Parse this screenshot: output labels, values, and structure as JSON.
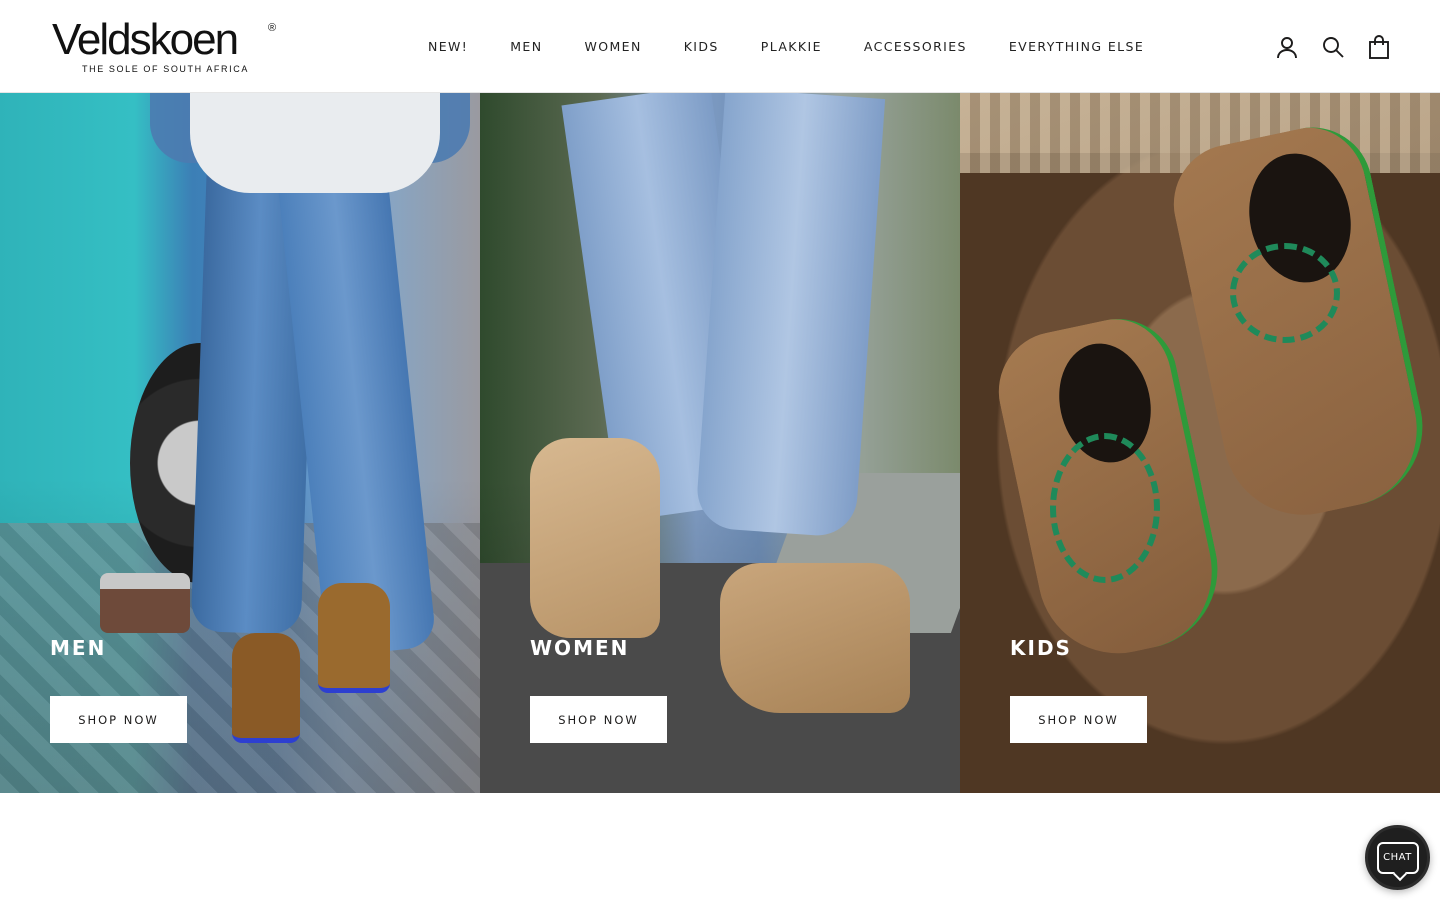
{
  "brand": {
    "name": "Veldskoen",
    "registered": "®",
    "tagline": "THE SOLE OF SOUTH AFRICA"
  },
  "nav": {
    "items": [
      {
        "label": "NEW!"
      },
      {
        "label": "MEN"
      },
      {
        "label": "WOMEN"
      },
      {
        "label": "KIDS"
      },
      {
        "label": "PLAKKIE"
      },
      {
        "label": "ACCESSORIES"
      },
      {
        "label": "EVERYTHING ELSE"
      }
    ]
  },
  "header_icons": {
    "account": "user-icon",
    "search": "search-icon",
    "cart": "shopping-bag-icon"
  },
  "collections": [
    {
      "title": "MEN",
      "button": "SHOP NOW"
    },
    {
      "title": "WOMEN",
      "button": "SHOP NOW"
    },
    {
      "title": "KIDS",
      "button": "SHOP NOW"
    }
  ],
  "chat": {
    "label": "CHAT",
    "icon": "chat-bubble-icon"
  }
}
